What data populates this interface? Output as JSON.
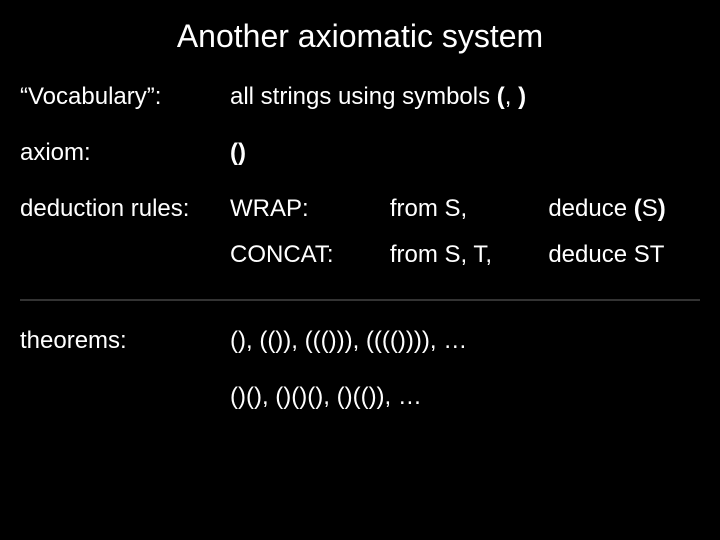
{
  "title": "Another axiomatic system",
  "vocab": {
    "label": "“Vocabulary”:",
    "text_pre": "all strings using symbols ",
    "sym1": "(",
    "comma": ", ",
    "sym2": ")"
  },
  "axiom": {
    "label": "axiom:",
    "value": "()"
  },
  "rules": {
    "label": "deduction rules:",
    "r1": {
      "name": "WRAP:",
      "from": "from S,",
      "deduce_pre": "deduce ",
      "open": "(",
      "mid": "S",
      "close": ")"
    },
    "r2": {
      "name": "CONCAT:",
      "from": "from S, T,",
      "deduce": "deduce ST"
    }
  },
  "theorems": {
    "label": "theorems:",
    "line1": "(),  (()),  ((())),  (((()))), …",
    "line2": "()(),  ()()(),  ()(()), …"
  }
}
